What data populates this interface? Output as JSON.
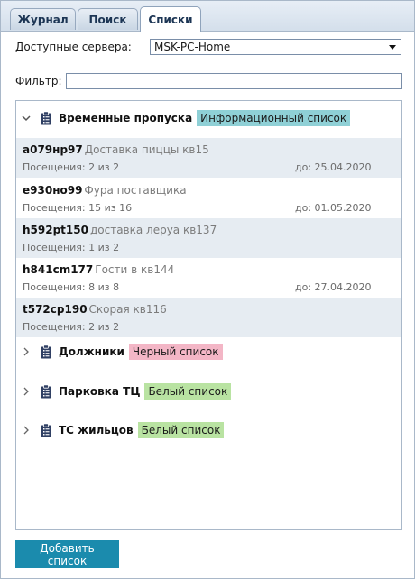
{
  "tabs": [
    {
      "label": "Журнал"
    },
    {
      "label": "Поиск"
    },
    {
      "label": "Списки"
    }
  ],
  "servers": {
    "label": "Доступные сервера:",
    "selected": "MSK-PC-Home"
  },
  "filter": {
    "label": "Фильтр:",
    "value": ""
  },
  "groups": [
    {
      "name": "Временные пропуска",
      "badge": "Информационный список",
      "badge_color": "#8fd0d6",
      "expanded": true,
      "items": [
        {
          "plate": "а079нр97",
          "desc": "Доставка пиццы кв15",
          "visits": "Посещения: 2 из 2",
          "until": "до: 25.04.2020"
        },
        {
          "plate": "е930но99",
          "desc": "Фура поставщика",
          "visits": "Посещения: 15 из 16",
          "until": "до: 01.05.2020"
        },
        {
          "plate": "h592рt150",
          "desc": "доставка леруа кв137",
          "visits": "Посещения: 1 из 2",
          "until": ""
        },
        {
          "plate": "h841cm177",
          "desc": "Гости в кв144",
          "visits": "Посещения: 8 из 8",
          "until": "до: 27.04.2020"
        },
        {
          "plate": "t572cp190",
          "desc": "Скорая кв116",
          "visits": "Посещения: 2 из 2",
          "until": ""
        }
      ]
    },
    {
      "name": "Должники",
      "badge": "Черный список",
      "badge_color": "#f3b6c6",
      "expanded": false
    },
    {
      "name": "Парковка ТЦ",
      "badge": "Белый список",
      "badge_color": "#b9e3a2",
      "expanded": false
    },
    {
      "name": "ТС жильцов",
      "badge": "Белый список",
      "badge_color": "#b9e3a2",
      "expanded": false
    }
  ],
  "add_button": {
    "label": "Добавить список"
  },
  "colors": {
    "accent": "#1b8bad",
    "row_shade": "#e6ecf2"
  }
}
